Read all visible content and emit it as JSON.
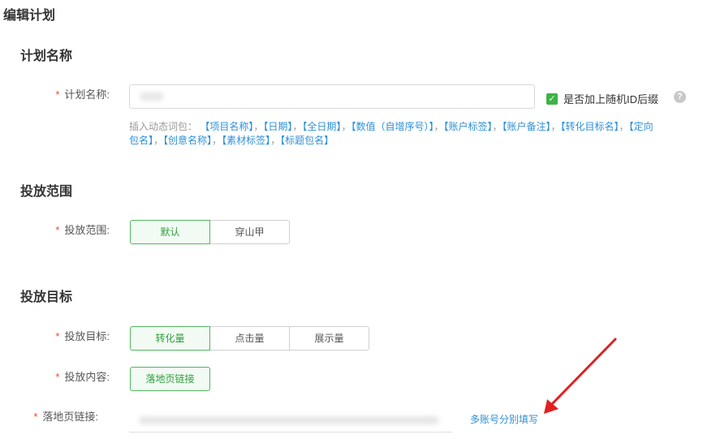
{
  "page": {
    "title": "编辑计划"
  },
  "plan_section": {
    "title": "计划名称",
    "name_label": "计划名称:",
    "name_value": "",
    "random_id_checkbox": {
      "label": "是否加上随机ID后缀",
      "checked": true
    },
    "help_icon": "question-icon",
    "insert_prefix": "插入动态词包：",
    "tokens": [
      "【项目名称】",
      "【日期】",
      "【全日期】",
      "【数值（自增序号）】",
      "【账户标签】",
      "【账户备注】",
      "【转化目标名】",
      "【定向",
      "包名】",
      "【创意名称】",
      "【素材标签】",
      "【标题包名】"
    ],
    "separator": "，"
  },
  "range_section": {
    "title": "投放范围",
    "label": "投放范围:",
    "options": [
      "默认",
      "穿山甲"
    ],
    "selected": "默认"
  },
  "target_section": {
    "title": "投放目标",
    "target_label": "投放目标:",
    "target_options": [
      "转化量",
      "点击量",
      "展示量"
    ],
    "target_selected": "转化量",
    "content_label": "投放内容:",
    "content_option": "落地页链接",
    "landing_label": "落地页链接:",
    "landing_value": "",
    "multi_account_link": "多账号分别填写"
  },
  "colors": {
    "accent_green": "#3bb346",
    "link_blue": "#2e8fd6",
    "required_red": "#e74c3c",
    "annotation_arrow": "#e02020"
  }
}
